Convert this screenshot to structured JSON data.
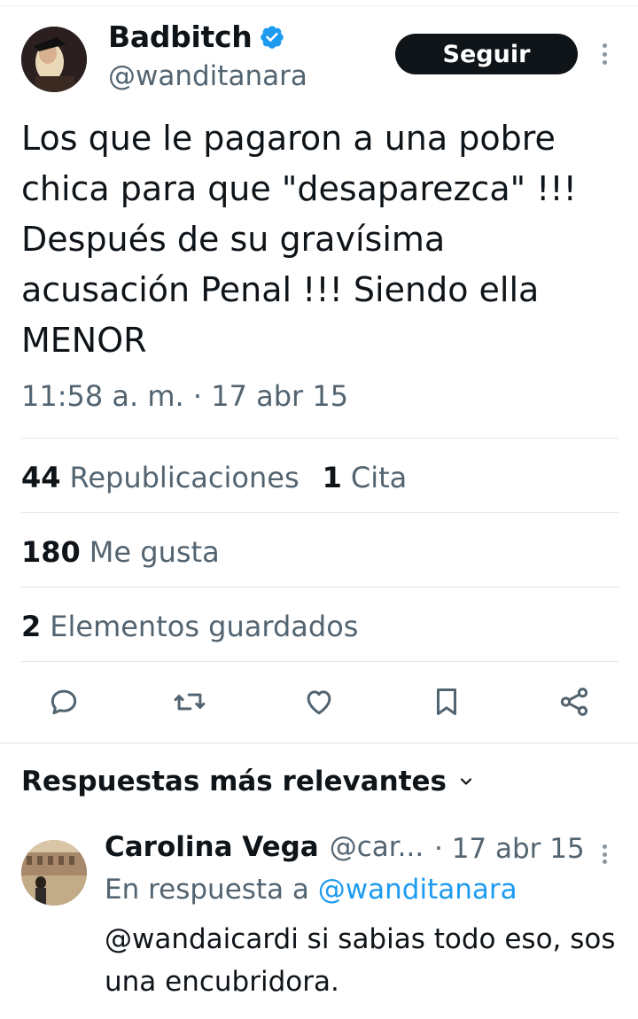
{
  "tweet": {
    "author": {
      "display_name": "Badbitch",
      "handle": "@wanditanara",
      "verified": true,
      "verified_color": "#1d9bf0"
    },
    "follow_label": "Seguir",
    "text": "Los que le pagaron a una pobre\nchica para que \"desaparezca\" !!!\nDespués de su gravísima\nacusación Penal !!! Siendo ella\nMENOR",
    "timestamp": "11:58 a. m. · 17 abr 15",
    "stats": {
      "reposts_count": "44",
      "reposts_label": "Republicaciones",
      "quotes_count": "1",
      "quotes_label": "Cita",
      "likes_count": "180",
      "likes_label": "Me gusta",
      "bookmarks_count": "2",
      "bookmarks_label": "Elementos guardados"
    },
    "actions": [
      "reply-icon",
      "repost-icon",
      "like-icon",
      "bookmark-icon",
      "share-icon"
    ]
  },
  "replies": {
    "sort_label": "Respuestas más relevantes",
    "items": [
      {
        "display_name": "Carolina Vega",
        "handle": "@car...",
        "date": "· 17 abr 15",
        "reply_prefix": "En respuesta a",
        "reply_target": "@wanditanara",
        "text": "@wandaicardi si sabias todo eso, sos una encubridora."
      }
    ]
  },
  "colors": {
    "text_primary": "#0f1419",
    "text_secondary": "#536471",
    "link": "#1d9bf0",
    "divider": "#e1e6e9"
  }
}
